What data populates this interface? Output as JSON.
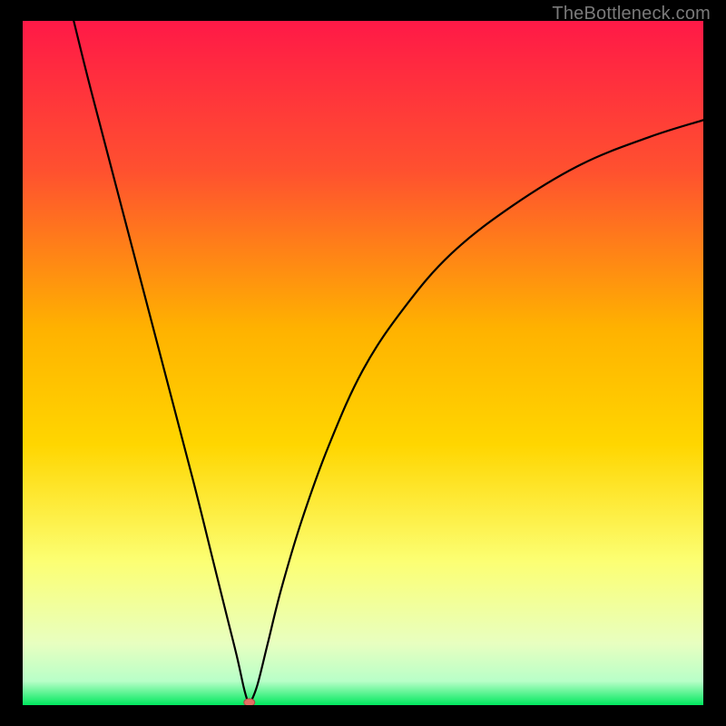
{
  "watermark": "TheBottleneck.com",
  "colors": {
    "bg": "#000000",
    "gradient_top": "#FF1947",
    "gradient_mid_upper": "#FF7B30",
    "gradient_mid": "#FFD600",
    "gradient_mid_lower": "#FDFE84",
    "gradient_lower": "#F6FFB5",
    "gradient_bottom": "#00E85E",
    "curve": "#000000",
    "marker_fill": "#E46E63",
    "marker_stroke": "#A94D46"
  },
  "chart_data": {
    "type": "line",
    "title": "",
    "xlabel": "",
    "ylabel": "",
    "xlim": [
      0,
      100
    ],
    "ylim": [
      0,
      100
    ],
    "curve_branches": [
      {
        "name": "left-descending",
        "points": [
          {
            "x": 7.5,
            "y": 100
          },
          {
            "x": 10,
            "y": 90
          },
          {
            "x": 15,
            "y": 71
          },
          {
            "x": 20,
            "y": 52
          },
          {
            "x": 25,
            "y": 33
          },
          {
            "x": 28,
            "y": 21
          },
          {
            "x": 30,
            "y": 13
          },
          {
            "x": 31.5,
            "y": 7
          },
          {
            "x": 32.5,
            "y": 2.5
          },
          {
            "x": 33.1,
            "y": 0.4
          }
        ]
      },
      {
        "name": "right-ascending",
        "points": [
          {
            "x": 33.5,
            "y": 0.4
          },
          {
            "x": 34.5,
            "y": 3
          },
          {
            "x": 36,
            "y": 9
          },
          {
            "x": 38,
            "y": 17
          },
          {
            "x": 41,
            "y": 27
          },
          {
            "x": 45,
            "y": 38
          },
          {
            "x": 50,
            "y": 49
          },
          {
            "x": 56,
            "y": 58
          },
          {
            "x": 63,
            "y": 66
          },
          {
            "x": 72,
            "y": 73
          },
          {
            "x": 82,
            "y": 79
          },
          {
            "x": 92,
            "y": 83
          },
          {
            "x": 100,
            "y": 85.5
          }
        ]
      }
    ],
    "marker": {
      "x": 33.3,
      "y": 0.4,
      "rx": 0.8,
      "ry": 0.55
    }
  }
}
